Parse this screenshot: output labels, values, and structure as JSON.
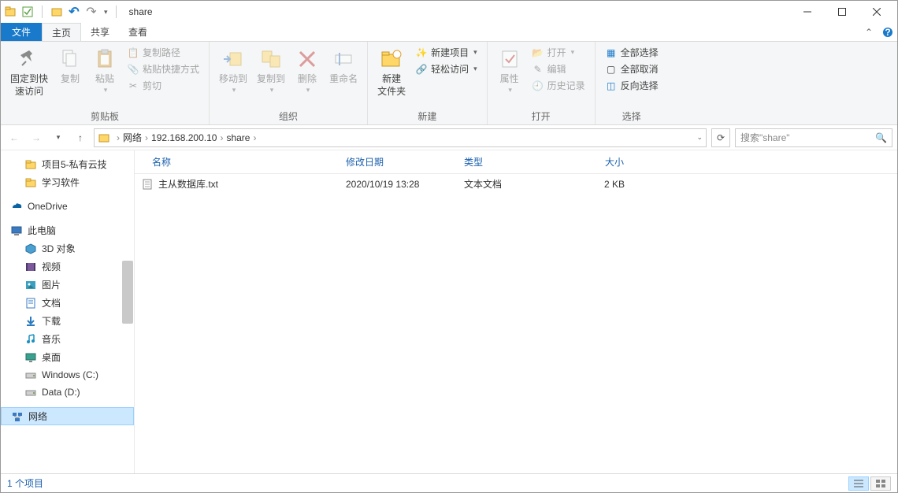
{
  "title": "share",
  "menu": {
    "file": "文件",
    "home": "主页",
    "share": "共享",
    "view": "查看"
  },
  "ribbon": {
    "clipboard": {
      "label": "剪贴板",
      "pin": "固定到快\n速访问",
      "copy": "复制",
      "paste": "粘贴",
      "copypath": "复制路径",
      "pasteshortcut": "粘贴快捷方式",
      "cut": "剪切"
    },
    "organize": {
      "label": "组织",
      "moveto": "移动到",
      "copyto": "复制到",
      "delete": "删除",
      "rename": "重命名"
    },
    "new": {
      "label": "新建",
      "newfolder": "新建\n文件夹",
      "newitem": "新建项目",
      "easyaccess": "轻松访问"
    },
    "open": {
      "label": "打开",
      "props": "属性",
      "open": "打开",
      "edit": "编辑",
      "history": "历史记录"
    },
    "select": {
      "label": "选择",
      "selectall": "全部选择",
      "selectnone": "全部取消",
      "invert": "反向选择"
    }
  },
  "address": {
    "segments": [
      "网络",
      "192.168.200.10",
      "share"
    ]
  },
  "search_placeholder": "搜索\"share\"",
  "columns": {
    "name": "名称",
    "date": "修改日期",
    "type": "类型",
    "size": "大小"
  },
  "sidebar": [
    {
      "label": "项目5-私有云技",
      "icon": "folder",
      "indent": 1
    },
    {
      "label": "学习软件",
      "icon": "folder",
      "indent": 1
    },
    {
      "label": "OneDrive",
      "icon": "onedrive",
      "indent": 0,
      "gap": true
    },
    {
      "label": "此电脑",
      "icon": "pc",
      "indent": 0,
      "gap": true
    },
    {
      "label": "3D 对象",
      "icon": "3d",
      "indent": 1
    },
    {
      "label": "视频",
      "icon": "video",
      "indent": 1
    },
    {
      "label": "图片",
      "icon": "pictures",
      "indent": 1
    },
    {
      "label": "文档",
      "icon": "docs",
      "indent": 1
    },
    {
      "label": "下载",
      "icon": "downloads",
      "indent": 1
    },
    {
      "label": "音乐",
      "icon": "music",
      "indent": 1
    },
    {
      "label": "桌面",
      "icon": "desktop",
      "indent": 1
    },
    {
      "label": "Windows (C:)",
      "icon": "drive",
      "indent": 1
    },
    {
      "label": "Data (D:)",
      "icon": "drive",
      "indent": 1
    },
    {
      "label": "网络",
      "icon": "network",
      "indent": 0,
      "gap": true,
      "selected": true
    }
  ],
  "files": [
    {
      "name": "主从数据库.txt",
      "date": "2020/10/19 13:28",
      "type": "文本文档",
      "size": "2 KB"
    }
  ],
  "status": "1 个项目"
}
